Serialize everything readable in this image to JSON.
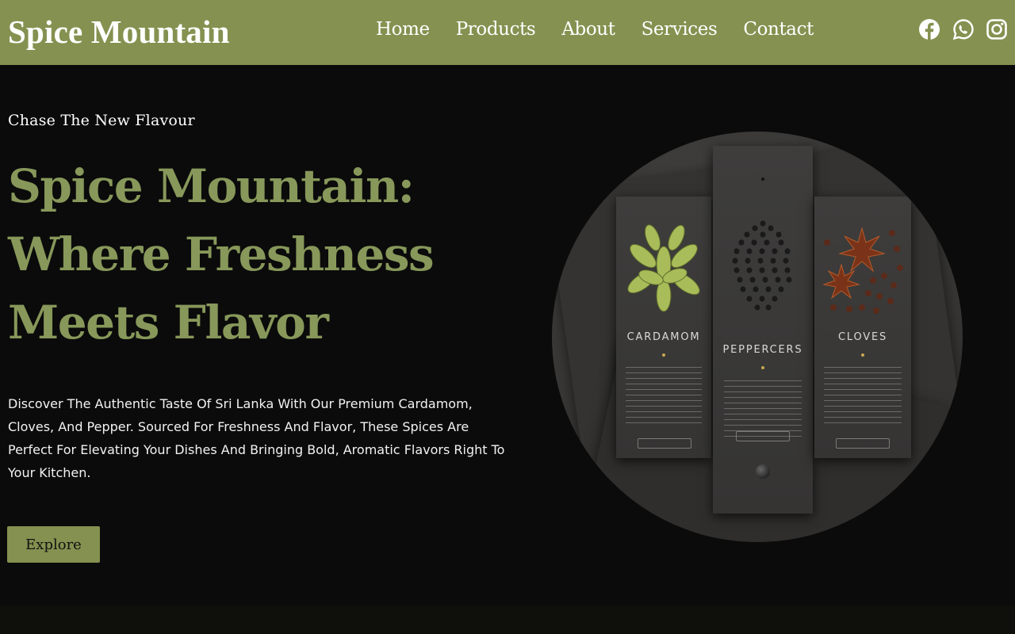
{
  "brand": {
    "name": "Spice Mountain"
  },
  "nav": {
    "items": [
      {
        "label": "Home"
      },
      {
        "label": "Products"
      },
      {
        "label": "About"
      },
      {
        "label": "Services"
      },
      {
        "label": "Contact"
      }
    ]
  },
  "social": {
    "icons": [
      "facebook-icon",
      "whatsapp-icon",
      "instagram-icon"
    ]
  },
  "hero": {
    "tagline": "Chase The New Flavour",
    "headline_lines": [
      "Spice Mountain:",
      "Where Freshness",
      "Meets Flavor"
    ],
    "description": "Discover The Authentic Taste Of Sri Lanka With Our Premium Cardamom, Cloves, And Pepper. Sourced For Freshness And Flavor, These Spices Are Perfect For Elevating Your Dishes And Bringing Bold, Aromatic Flavors Right To Your Kitchen.",
    "cta_label": "Explore"
  },
  "product_image": {
    "labels": [
      "CARDAMOM",
      "PEPPERCERS",
      "CLOVES"
    ]
  },
  "colors": {
    "accent": "#859150",
    "headline": "#87985a",
    "background": "#0b0b0b"
  }
}
